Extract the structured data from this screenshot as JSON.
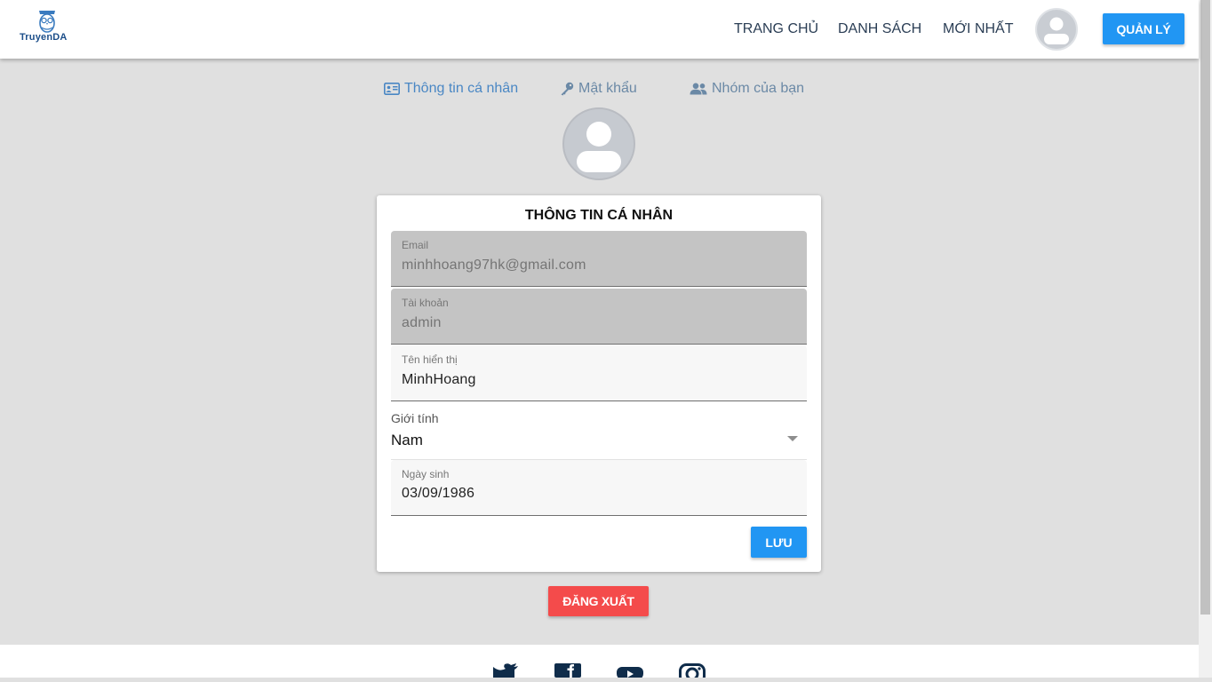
{
  "header": {
    "logo_text": "TruyenDA",
    "nav": [
      "TRANG CHỦ",
      "DANH SÁCH",
      "MỚI NHẤT"
    ],
    "manage_label": "QUẢN LÝ"
  },
  "tabs": {
    "personal": "Thông tin cá nhân",
    "password": "Mật khẩu",
    "groups": "Nhóm của bạn"
  },
  "card": {
    "title": "THÔNG TIN CÁ NHÂN",
    "email": {
      "label": "Email",
      "value": "minhhoang97hk@gmail.com"
    },
    "account": {
      "label": "Tài khoản",
      "value": "admin"
    },
    "display_name": {
      "label": "Tên hiển thị",
      "value": "MinhHoang"
    },
    "gender": {
      "label": "Giới tính",
      "value": "Nam"
    },
    "birthday": {
      "label": "Ngày sinh",
      "value": "03/09/1986"
    },
    "save_label": "LƯU"
  },
  "logout_label": "ĐĂNG XUẤT",
  "icons": {
    "tab_personal": "id-card-icon",
    "tab_password": "key-icon",
    "tab_groups": "users-icon",
    "footer": [
      "twitter-icon",
      "facebook-icon",
      "youtube-icon",
      "instagram-icon"
    ]
  },
  "colors": {
    "primary": "#2196f3",
    "danger": "#f44b4b",
    "tab_active": "#4a87c4",
    "footer_icon": "#0f2c4a"
  }
}
